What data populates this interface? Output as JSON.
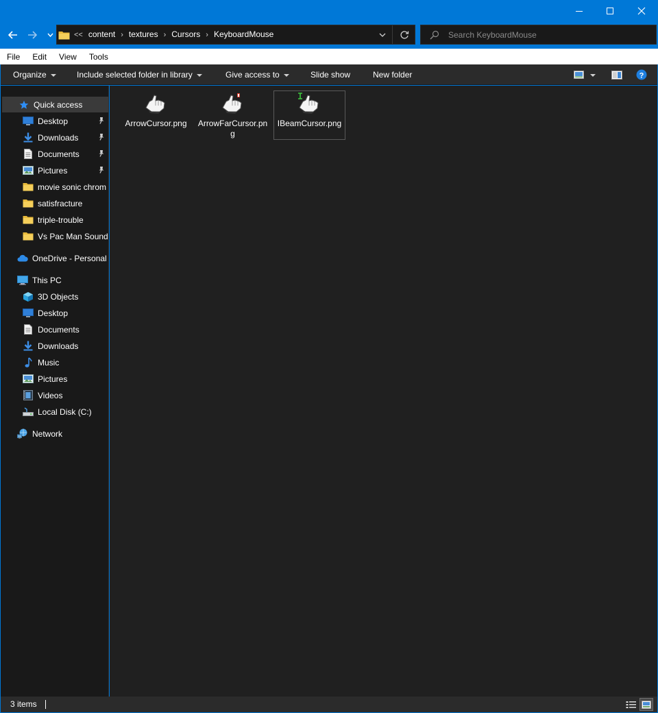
{
  "window": {
    "minimize_label": "Minimize",
    "maximize_label": "Maximize",
    "close_label": "Close"
  },
  "address": {
    "overflow": "<<",
    "crumbs": [
      "content",
      "textures",
      "Cursors",
      "KeyboardMouse"
    ]
  },
  "search": {
    "placeholder": "Search KeyboardMouse"
  },
  "menu": {
    "items": [
      "File",
      "Edit",
      "View",
      "Tools"
    ]
  },
  "toolbar": {
    "organize": "Organize",
    "include": "Include selected folder in library",
    "give_access": "Give access to",
    "slide_show": "Slide show",
    "new_folder": "New folder"
  },
  "nav": {
    "quick_access": "Quick access",
    "quick_items": [
      "Desktop",
      "Downloads",
      "Documents",
      "Pictures",
      "movie sonic chrom",
      "satisfracture",
      "triple-trouble",
      "Vs Pac Man Sound"
    ],
    "onedrive": "OneDrive - Personal",
    "this_pc": "This PC",
    "pc_items": [
      "3D Objects",
      "Desktop",
      "Documents",
      "Downloads",
      "Music",
      "Pictures",
      "Videos",
      "Local Disk (C:)"
    ],
    "network": "Network"
  },
  "files": [
    {
      "name": "ArrowCursor.png"
    },
    {
      "name": "ArrowFarCursor.png"
    },
    {
      "name": "IBeamCursor.png"
    }
  ],
  "status": {
    "count": "3 items"
  },
  "colors": {
    "accent": "#0078d7",
    "nav_bg": "#191919",
    "content_bg": "#202020",
    "toolbar_bg": "#2b2b2b",
    "folder": "#f0c040",
    "help": "#1e90ff"
  }
}
